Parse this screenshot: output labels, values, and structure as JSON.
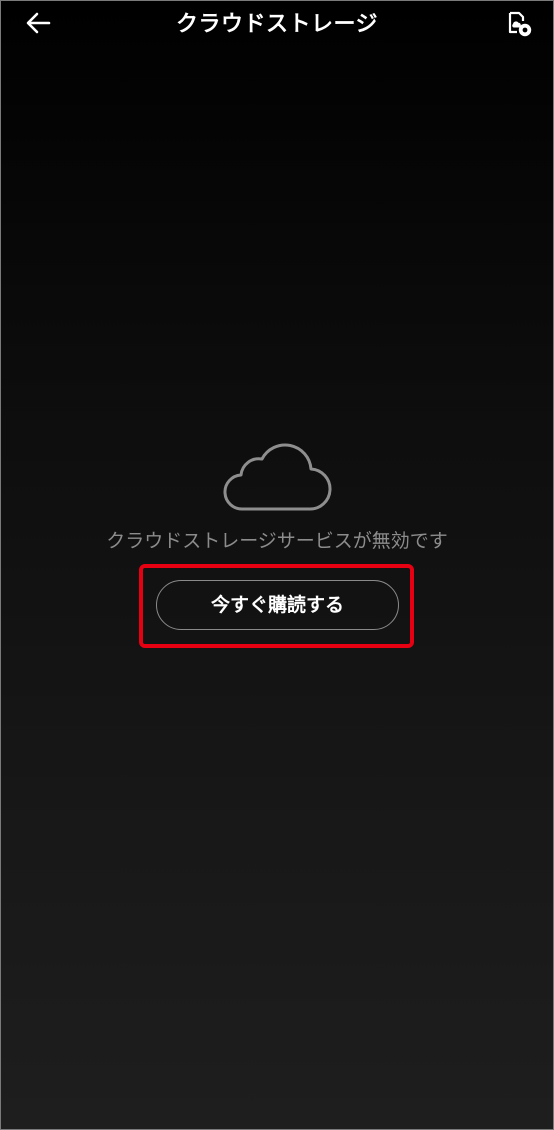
{
  "header": {
    "title": "クラウドストレージ",
    "back_icon": "arrow-left-icon",
    "settings_icon": "cloud-settings-icon"
  },
  "main": {
    "icon": "cloud-outline-icon",
    "message": "クラウドストレージサービスが無効です",
    "subscribe_label": "今すぐ購読する"
  },
  "colors": {
    "highlight": "#e60012",
    "message_text": "#8c8c8c",
    "background_top": "#000000",
    "background_bottom": "#1e1e1e"
  }
}
